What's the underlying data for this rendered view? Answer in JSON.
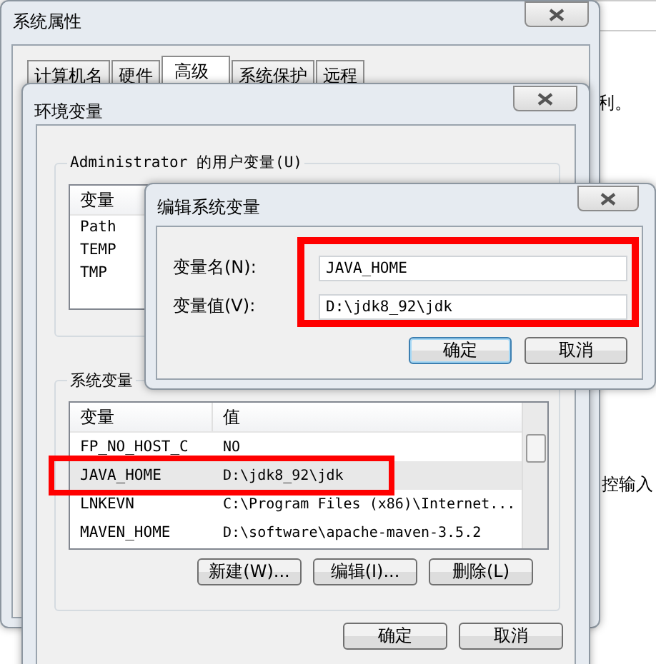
{
  "behind_window": {
    "fragments": [
      "利。",
      "控输入"
    ]
  },
  "system_properties": {
    "title": "系统属性",
    "tabs": [
      {
        "label": "计算机名",
        "selected": false
      },
      {
        "label": "硬件",
        "selected": false
      },
      {
        "label": "高级",
        "selected": true
      },
      {
        "label": "系统保护",
        "selected": false
      },
      {
        "label": "远程",
        "selected": false
      }
    ]
  },
  "environment_variables": {
    "title": "环境变量",
    "user_variables": {
      "title": "Administrator 的用户变量(U)",
      "columns": [
        "变量"
      ],
      "rows": [
        {
          "name": "Path",
          "selected": false
        },
        {
          "name": "TEMP",
          "selected": false
        },
        {
          "name": "TMP",
          "selected": false
        }
      ]
    },
    "system_variables": {
      "title": "系统变量",
      "columns": [
        "变量",
        "值"
      ],
      "rows": [
        {
          "name": "FP_NO_HOST_C",
          "value": "NO",
          "selected": false
        },
        {
          "name": "JAVA_HOME",
          "value": "D:\\jdk8_92\\jdk",
          "selected": true
        },
        {
          "name": "LNKEVN",
          "value": "C:\\Program Files (x86)\\Internet...",
          "selected": false
        },
        {
          "name": "MAVEN_HOME",
          "value": "D:\\software\\apache-maven-3.5.2",
          "selected": false
        }
      ]
    },
    "list_buttons": [
      "新建(W)...",
      "编辑(I)...",
      "删除(L)"
    ],
    "buttons": [
      "确定",
      "取消"
    ]
  },
  "edit_dialog": {
    "title": "编辑系统变量",
    "fields": [
      {
        "label": "变量名(N):",
        "value": "JAVA_HOME"
      },
      {
        "label": "变量值(V):",
        "value": "D:\\jdk8_92\\jdk"
      }
    ],
    "buttons": [
      "确定",
      "取消"
    ]
  }
}
